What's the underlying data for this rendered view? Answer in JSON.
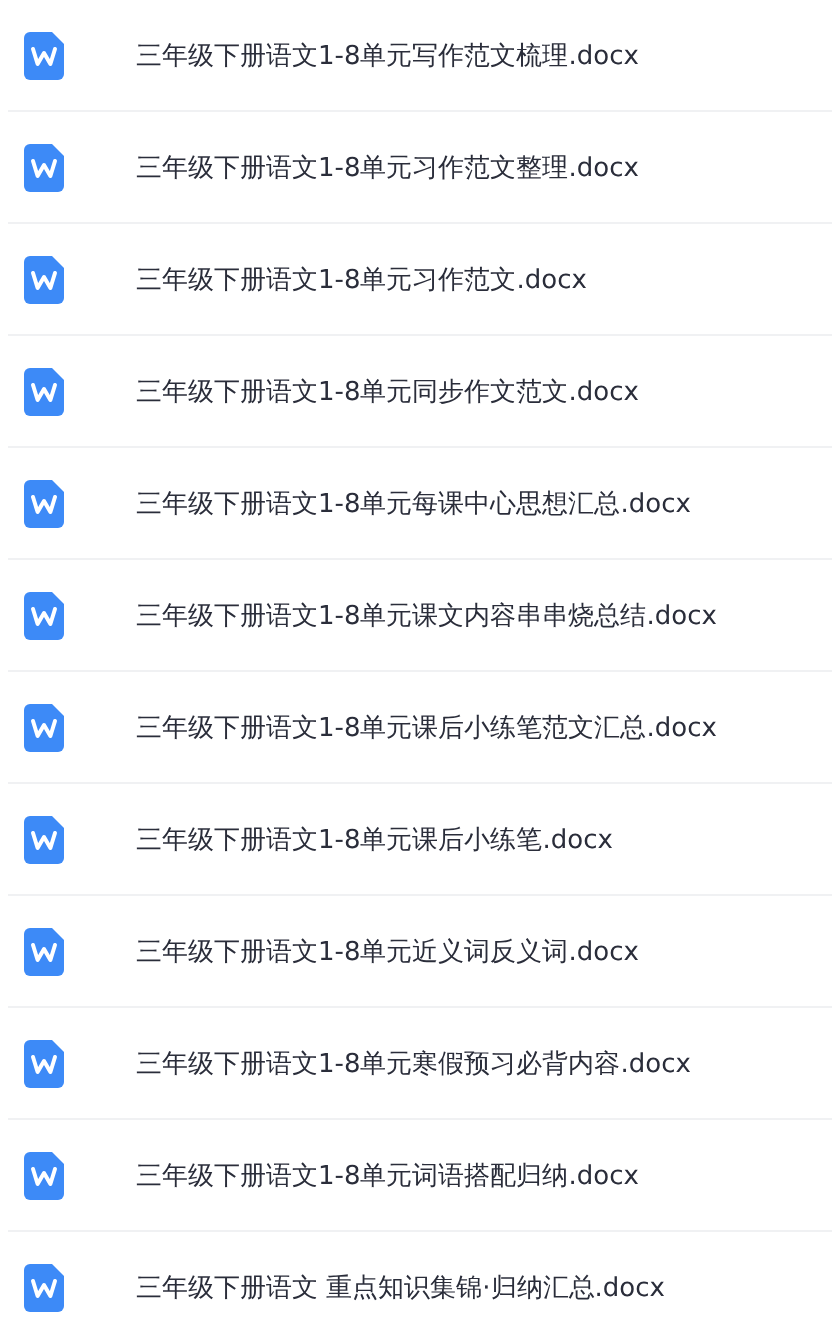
{
  "files": [
    {
      "name": "三年级下册语文1-8单元写作范文梳理.docx"
    },
    {
      "name": "三年级下册语文1-8单元习作范文整理.docx"
    },
    {
      "name": "三年级下册语文1-8单元习作范文.docx"
    },
    {
      "name": "三年级下册语文1-8单元同步作文范文.docx"
    },
    {
      "name": "三年级下册语文1-8单元每课中心思想汇总.docx"
    },
    {
      "name": "三年级下册语文1-8单元课文内容串串烧总结.docx"
    },
    {
      "name": "三年级下册语文1-8单元课后小练笔范文汇总.docx"
    },
    {
      "name": "三年级下册语文1-8单元课后小练笔.docx"
    },
    {
      "name": "三年级下册语文1-8单元近义词反义词.docx"
    },
    {
      "name": "三年级下册语文1-8单元寒假预习必背内容.docx"
    },
    {
      "name": "三年级下册语文1-8单元词语搭配归纳.docx"
    },
    {
      "name": "三年级下册语文 重点知识集锦·归纳汇总.docx"
    }
  ]
}
